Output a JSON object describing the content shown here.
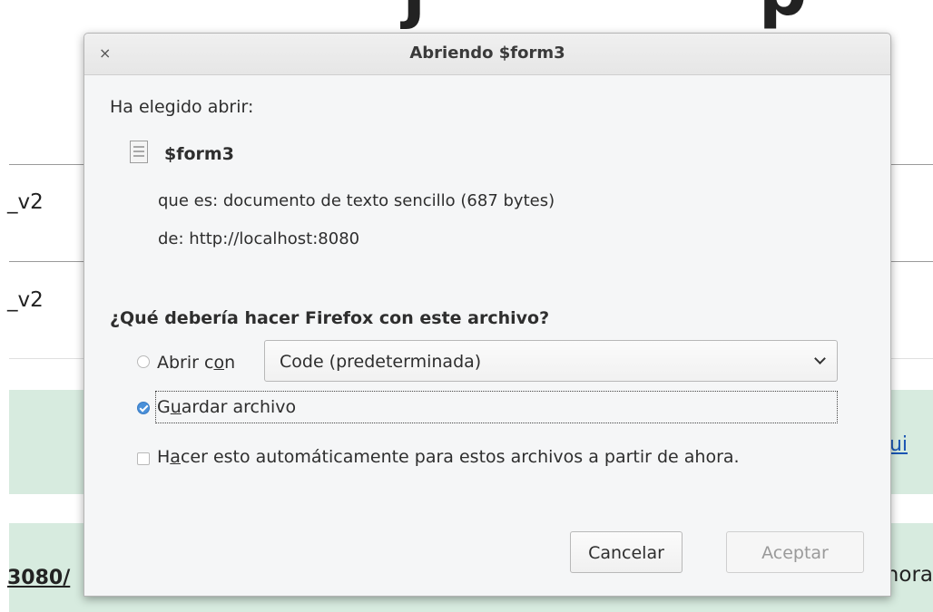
{
  "background": {
    "title": "· · · · j · · · · · p",
    "row1_label": "_v2",
    "row2_label": "_v2",
    "right_link": "ui",
    "url_fragment": "3080/",
    "right_text": "hora"
  },
  "dialog": {
    "title": "Abriendo $form3",
    "close_glyph": "×",
    "intro": "Ha elegido abrir:",
    "file_name": "$form3",
    "type_line": "que es:  documento de texto sencillo (687 bytes)",
    "from_line": "de:  http://localhost:8080",
    "question": "¿Qué debería hacer Firefox con este archivo?",
    "open_with": {
      "label_prefix": "Abrir c",
      "label_accel": "o",
      "label_suffix": "n",
      "selected_app": "Code (predeterminada)",
      "checked": false
    },
    "save_file": {
      "label_prefix": "G",
      "label_accel": "u",
      "label_suffix": "ardar archivo",
      "checked": true
    },
    "auto_checkbox": {
      "label_prefix": "H",
      "label_accel": "a",
      "label_suffix": "cer esto automáticamente para estos archivos a partir de ahora.",
      "checked": false
    },
    "buttons": {
      "cancel": "Cancelar",
      "accept": "Aceptar"
    }
  },
  "colors": {
    "accent": "#4a90d9",
    "band": "#d7ebdf",
    "link": "#1a55b3"
  }
}
